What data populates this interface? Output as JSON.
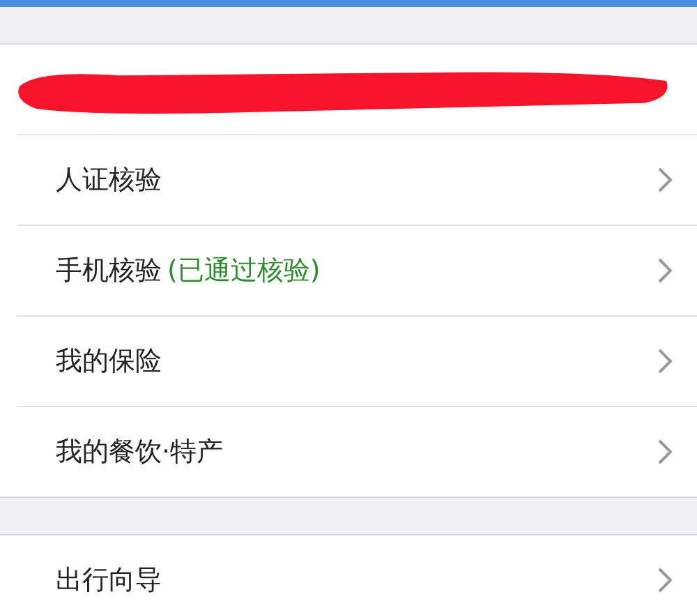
{
  "sections": [
    {
      "items": [
        {
          "kind": "redacted"
        },
        {
          "kind": "link",
          "label": "人证核验"
        },
        {
          "kind": "link",
          "label": "手机核验",
          "status": "(已通过核验)"
        },
        {
          "kind": "link",
          "label": "我的保险"
        },
        {
          "kind": "link",
          "label": "我的餐饮·特产"
        }
      ]
    },
    {
      "items": [
        {
          "kind": "link",
          "label": "出行向导"
        }
      ]
    }
  ]
}
